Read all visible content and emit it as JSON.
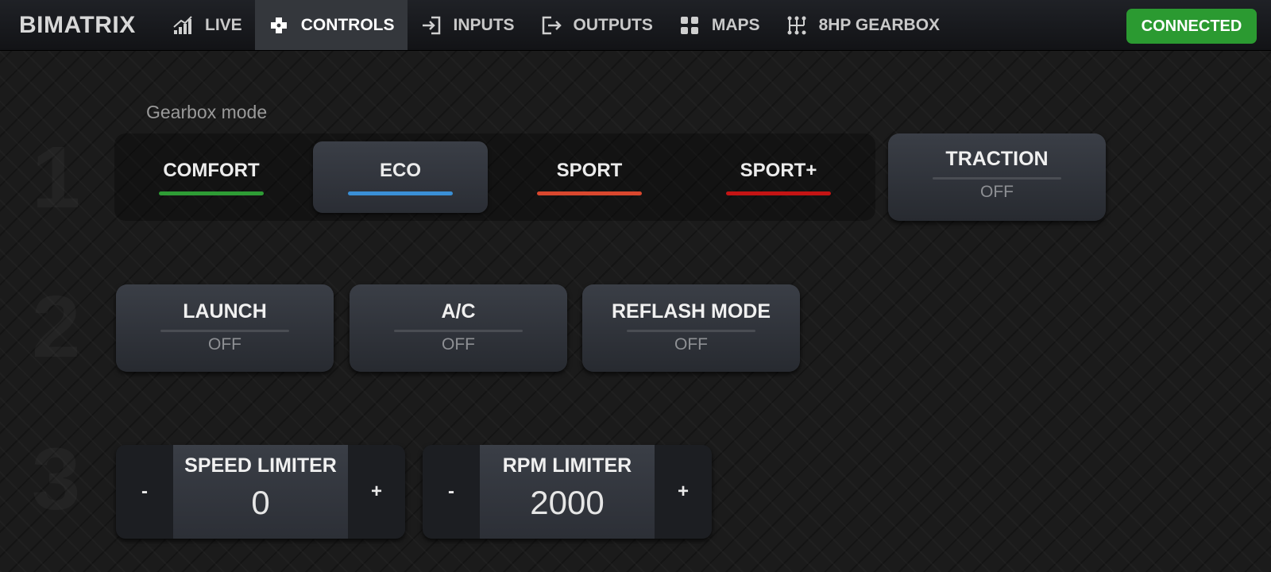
{
  "brand": "BIMATRIX",
  "nav": [
    {
      "label": "LIVE",
      "icon": "signal-bars-icon"
    },
    {
      "label": "CONTROLS",
      "icon": "gamepad-icon",
      "active": true
    },
    {
      "label": "INPUTS",
      "icon": "input-arrow-icon"
    },
    {
      "label": "OUTPUTS",
      "icon": "output-arrow-icon"
    },
    {
      "label": "MAPS",
      "icon": "grid-icon"
    },
    {
      "label": "8HP GEARBOX",
      "icon": "gear-shift-icon"
    }
  ],
  "status": {
    "label": "CONNECTED",
    "color": "#2b9a31"
  },
  "sections": [
    "1",
    "2",
    "3"
  ],
  "gearbox": {
    "label": "Gearbox mode",
    "modes": [
      {
        "label": "COMFORT",
        "color": "#2e9c35"
      },
      {
        "label": "ECO",
        "color": "#3a8fd6",
        "active": true
      },
      {
        "label": "SPORT",
        "color": "#d9472e"
      },
      {
        "label": "SPORT+",
        "color": "#c41414"
      }
    ]
  },
  "traction": {
    "title": "TRACTION",
    "value": "OFF"
  },
  "toggles": [
    {
      "title": "LAUNCH",
      "value": "OFF"
    },
    {
      "title": "A/C",
      "value": "OFF"
    },
    {
      "title": "REFLASH MODE",
      "value": "OFF"
    }
  ],
  "limiters": [
    {
      "title": "SPEED LIMITER",
      "value": "0",
      "minus": "-",
      "plus": "+"
    },
    {
      "title": "RPM LIMITER",
      "value": "2000",
      "minus": "-",
      "plus": "+"
    }
  ]
}
